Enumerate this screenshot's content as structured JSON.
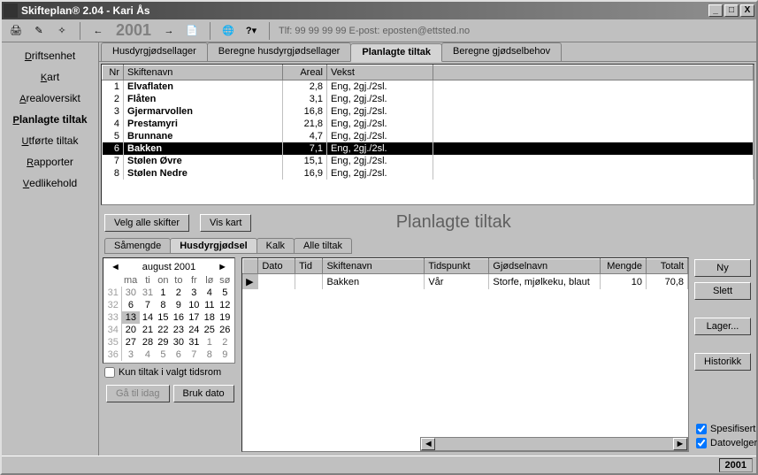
{
  "title": "Skifteplan® 2.04 - Kari Ås",
  "toolbar": {
    "year": "2001",
    "contact": "Tlf: 99 99 99 99  E-post: eposten@ettsted.no"
  },
  "sidebar": [
    "Driftsenhet",
    "Kart",
    "Arealoversikt",
    "Planlagte tiltak",
    "Utførte tiltak",
    "Rapporter",
    "Vedlikehold"
  ],
  "sidebar_sel": 3,
  "tabs": [
    "Husdyrgjødsellager",
    "Beregne husdyrgjødsellager",
    "Planlagte tiltak",
    "Beregne gjødselbehov"
  ],
  "tabs_sel": 2,
  "grid_head": {
    "nr": "Nr",
    "navn": "Skiftenavn",
    "areal": "Areal",
    "vekst": "Vekst"
  },
  "rows": [
    {
      "nr": "1",
      "navn": "Elvaflaten",
      "areal": "2,8",
      "vekst": "Eng, 2gj./2sl."
    },
    {
      "nr": "2",
      "navn": "Flåten",
      "areal": "3,1",
      "vekst": "Eng, 2gj./2sl."
    },
    {
      "nr": "3",
      "navn": "Gjermarvollen",
      "areal": "16,8",
      "vekst": "Eng, 2gj./2sl."
    },
    {
      "nr": "4",
      "navn": "Prestamyri",
      "areal": "21,8",
      "vekst": "Eng, 2gj./2sl."
    },
    {
      "nr": "5",
      "navn": "Brunnane",
      "areal": "4,7",
      "vekst": "Eng, 2gj./2sl."
    },
    {
      "nr": "6",
      "navn": "Bakken",
      "areal": "7,1",
      "vekst": "Eng, 2gj./2sl."
    },
    {
      "nr": "7",
      "navn": "Stølen Øvre",
      "areal": "15,1",
      "vekst": "Eng, 2gj./2sl."
    },
    {
      "nr": "8",
      "navn": "Stølen Nedre",
      "areal": "16,9",
      "vekst": "Eng, 2gj./2sl."
    }
  ],
  "rows_sel": 5,
  "mid": {
    "velg": "Velg alle skifter",
    "kart": "Vis kart",
    "title": "Planlagte tiltak"
  },
  "subtabs": [
    "Såmengde",
    "Husdyrgjødsel",
    "Kalk",
    "Alle tiltak"
  ],
  "subtabs_sel": 1,
  "cal": {
    "title": "august 2001",
    "days": [
      "ma",
      "ti",
      "on",
      "to",
      "fr",
      "lø",
      "sø"
    ],
    "weeks": [
      {
        "w": "31",
        "d": [
          "30",
          "31",
          "1",
          "2",
          "3",
          "4",
          "5"
        ],
        "dim": [
          0,
          1
        ]
      },
      {
        "w": "32",
        "d": [
          "6",
          "7",
          "8",
          "9",
          "10",
          "11",
          "12"
        ]
      },
      {
        "w": "33",
        "d": [
          "13",
          "14",
          "15",
          "16",
          "17",
          "18",
          "19"
        ],
        "today": 0
      },
      {
        "w": "34",
        "d": [
          "20",
          "21",
          "22",
          "23",
          "24",
          "25",
          "26"
        ]
      },
      {
        "w": "35",
        "d": [
          "27",
          "28",
          "29",
          "30",
          "31",
          "1",
          "2"
        ],
        "dim": [
          5,
          6
        ]
      },
      {
        "w": "36",
        "d": [
          "3",
          "4",
          "5",
          "6",
          "7",
          "8",
          "9"
        ],
        "dim": [
          0,
          1,
          2,
          3,
          4,
          5,
          6
        ]
      }
    ],
    "chk": "Kun tiltak i valgt tidsrom",
    "idag": "Gå til idag",
    "bruk": "Bruk dato"
  },
  "detail_head": {
    "dato": "Dato",
    "tid": "Tid",
    "navn": "Skiftenavn",
    "tids": "Tidspunkt",
    "gj": "Gjødselnavn",
    "mengde": "Mengde",
    "totalt": "Totalt"
  },
  "detail_row": {
    "dato": "",
    "tid": "",
    "navn": "Bakken",
    "tids": "Vår",
    "gj": "Storfe, mjølkeku, blaut",
    "mengde": "10",
    "totalt": "70,8"
  },
  "rbtns": {
    "ny": "Ny",
    "slett": "Slett",
    "lager": "Lager...",
    "hist": "Historikk"
  },
  "rchk": {
    "spes": "Spesifisert",
    "dato": "Datovelger"
  },
  "status": "2001"
}
